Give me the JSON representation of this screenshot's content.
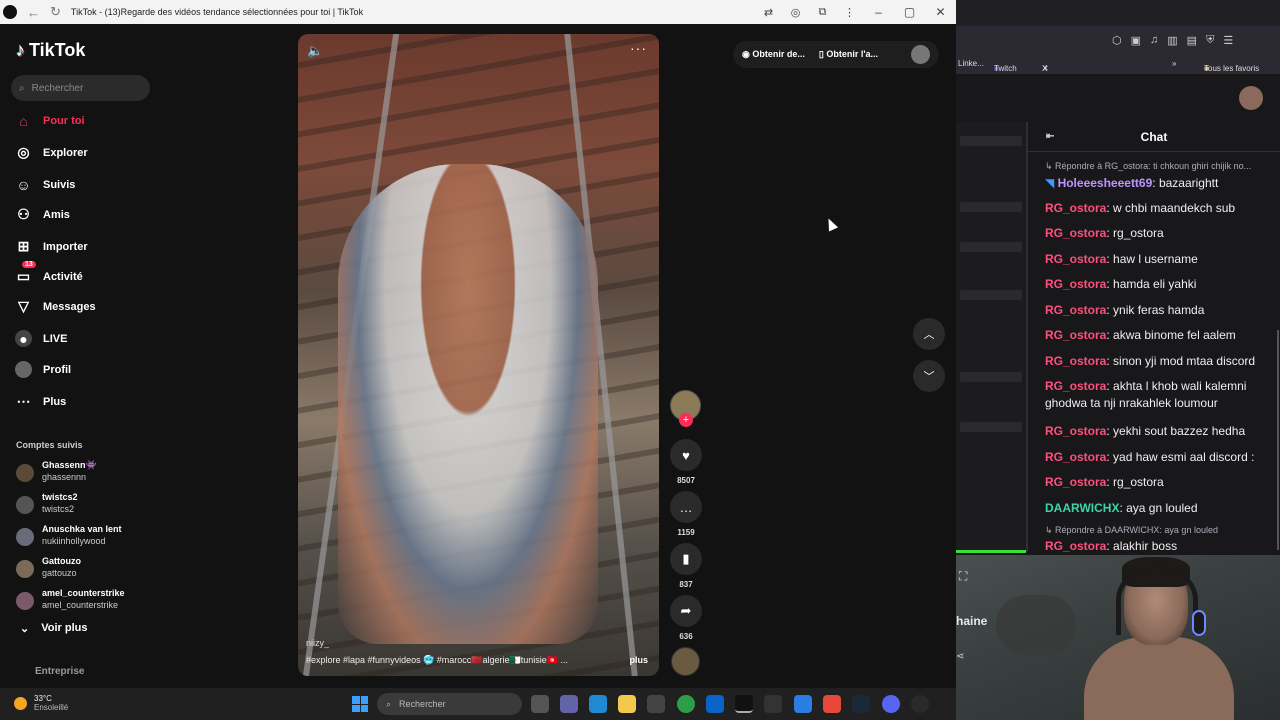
{
  "left_window": {
    "title": "TikTok - (13)Regarde des vidéos tendance sélectionnées pour toi | TikTok"
  },
  "tiktok": {
    "logo": "TikTok",
    "search_placeholder": "Rechercher",
    "nav": [
      {
        "label": "Pour toi",
        "icon": "home-icon",
        "active": true
      },
      {
        "label": "Explorer",
        "icon": "compass-icon"
      },
      {
        "label": "Suivis",
        "icon": "following-icon"
      },
      {
        "label": "Amis",
        "icon": "friends-icon"
      },
      {
        "label": "Importer",
        "icon": "upload-icon"
      },
      {
        "label": "Activité",
        "icon": "inbox-icon",
        "badge": "13"
      },
      {
        "label": "Messages",
        "icon": "send-icon"
      },
      {
        "label": "LIVE",
        "icon": "live-icon"
      },
      {
        "label": "Profil",
        "icon": "profile-icon"
      },
      {
        "label": "Plus",
        "icon": "more-icon"
      }
    ],
    "followed_title": "Comptes suivis",
    "followed": [
      {
        "name": "Ghassenn👾",
        "handle": "ghassennn"
      },
      {
        "name": "twistcs2",
        "handle": "twistcs2"
      },
      {
        "name": "Anuschka van lent",
        "handle": "nukiinhollywood"
      },
      {
        "name": "Gattouzo",
        "handle": "gattouzo"
      },
      {
        "name": "amel_counterstrike",
        "handle": "amel_counterstrike"
      }
    ],
    "see_more": "Voir plus",
    "enterprise": "Entreprise",
    "video": {
      "author": "niizy_",
      "tags": "#explore #lapa #funnyvideos 🥶 #marocc🇲🇦algerie🇩🇿tunisie🇹🇳 ...",
      "more": "plus"
    },
    "actions": {
      "likes": "8507",
      "comments": "1159",
      "saves": "837",
      "shares": "636"
    },
    "top_actions": {
      "get_desktop": "Obtenir de...",
      "get_app": "Obtenir l'a..."
    }
  },
  "right_window": {
    "tabs": [
      "Linke...",
      "Twitch",
      "X"
    ],
    "bookmarks_all": "Tous les favoris",
    "chat_title": "Chat",
    "messages": [
      {
        "type": "reply",
        "text": "Répondre à RG_ostora: ti chkoun ghiri chijik no..."
      },
      {
        "user": "Holeeesheeett69",
        "color": "#bf94ff",
        "text": "bazaarightt"
      },
      {
        "user": "RG_ostora",
        "color": "#ff4f7a",
        "text": "w chbi maandekch sub"
      },
      {
        "user": "RG_ostora",
        "color": "#ff4f7a",
        "text": "rg_ostora"
      },
      {
        "user": "RG_ostora",
        "color": "#ff4f7a",
        "text": "haw l username"
      },
      {
        "user": "RG_ostora",
        "color": "#ff4f7a",
        "text": "hamda eli yahki"
      },
      {
        "user": "RG_ostora",
        "color": "#ff4f7a",
        "text": "ynik feras hamda"
      },
      {
        "user": "RG_ostora",
        "color": "#ff4f7a",
        "text": "akwa binome fel aalem"
      },
      {
        "user": "RG_ostora",
        "color": "#ff4f7a",
        "text": "sinon yji mod mtaa discord"
      },
      {
        "user": "RG_ostora",
        "color": "#ff4f7a",
        "text": "akhta l khob wali kalemni ghodwa ta nji nrakahlek loumour"
      },
      {
        "user": "RG_ostora",
        "color": "#ff4f7a",
        "text": "yekhi sout bazzez hedha"
      },
      {
        "user": "RG_ostora",
        "color": "#ff4f7a",
        "text": "yad haw esmi aal discord :"
      },
      {
        "user": "RG_ostora",
        "color": "#ff4f7a",
        "text": "rg_ostora"
      },
      {
        "user": "DAARWICHX",
        "color": "#3ad6a3",
        "text": "aya gn louled"
      },
      {
        "type": "reply",
        "text": "Répondre à DAARWICHX: aya gn louled"
      },
      {
        "user": "RG_ostora",
        "color": "#ff4f7a",
        "text": "alakhir boss"
      }
    ],
    "cam_label": "haine"
  },
  "taskbar": {
    "temp": "33°C",
    "weather": "Ensoleillé",
    "search_placeholder": "Rechercher"
  },
  "colors": {
    "tiktok_accent": "#fe2c55",
    "twitch_bg": "#18181b"
  }
}
